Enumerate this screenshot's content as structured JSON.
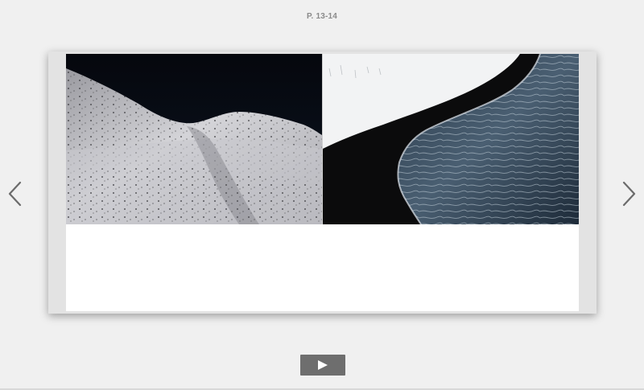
{
  "viewer": {
    "page_label": "P. 13-14",
    "prev_icon": "chevron-left-icon",
    "next_icon": "chevron-right-icon",
    "play_icon": "play-icon"
  },
  "colors": {
    "background": "#f0f0f0",
    "arrow": "#6b6b6b",
    "play_button": "#6e6e6e"
  }
}
